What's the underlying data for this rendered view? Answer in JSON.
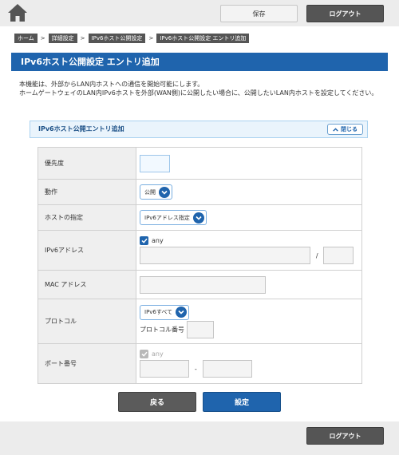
{
  "header": {
    "save_label": "保存",
    "logout_label": "ログアウト"
  },
  "breadcrumb": [
    "ホーム",
    "詳細設定",
    "IPv6ホスト公開設定",
    "IPv6ホスト公開設定 エントリ追加"
  ],
  "page_title": "IPv6ホスト公開設定 エントリ追加",
  "description": [
    "本機能は、外部からLAN内ホストへの通信を開始可能にします。",
    "ホームゲートウェイのLAN内IPv6ホストを外部(WAN側)に公開したい場合に、公開したいLAN内ホストを設定してください。"
  ],
  "section": {
    "title": "IPv6ホスト公開エントリ追加",
    "close_label": "閉じる"
  },
  "form": {
    "priority": {
      "label": "優先度",
      "value": ""
    },
    "action": {
      "label": "動作",
      "selected": "公開"
    },
    "host_spec": {
      "label": "ホストの指定",
      "selected": "IPv6アドレス指定"
    },
    "ipv6": {
      "label": "IPv6アドレス",
      "any_label": "any",
      "any_checked": true,
      "address": "",
      "prefix": "",
      "separator": "/"
    },
    "mac": {
      "label": "MAC アドレス",
      "value": ""
    },
    "protocol": {
      "label": "プロトコル",
      "selected": "IPv6すべて",
      "number_label": "プロトコル番号",
      "number": ""
    },
    "port": {
      "label": "ポート番号",
      "any_label": "any",
      "any_checked": true,
      "from": "",
      "to": "",
      "separator": "-"
    }
  },
  "buttons": {
    "back_label": "戻る",
    "set_label": "設定"
  },
  "footer": {
    "logout_label": "ログアウト"
  },
  "colors": {
    "primary": "#1f64ad",
    "dark_button": "#555555",
    "bar": "#ececec"
  }
}
